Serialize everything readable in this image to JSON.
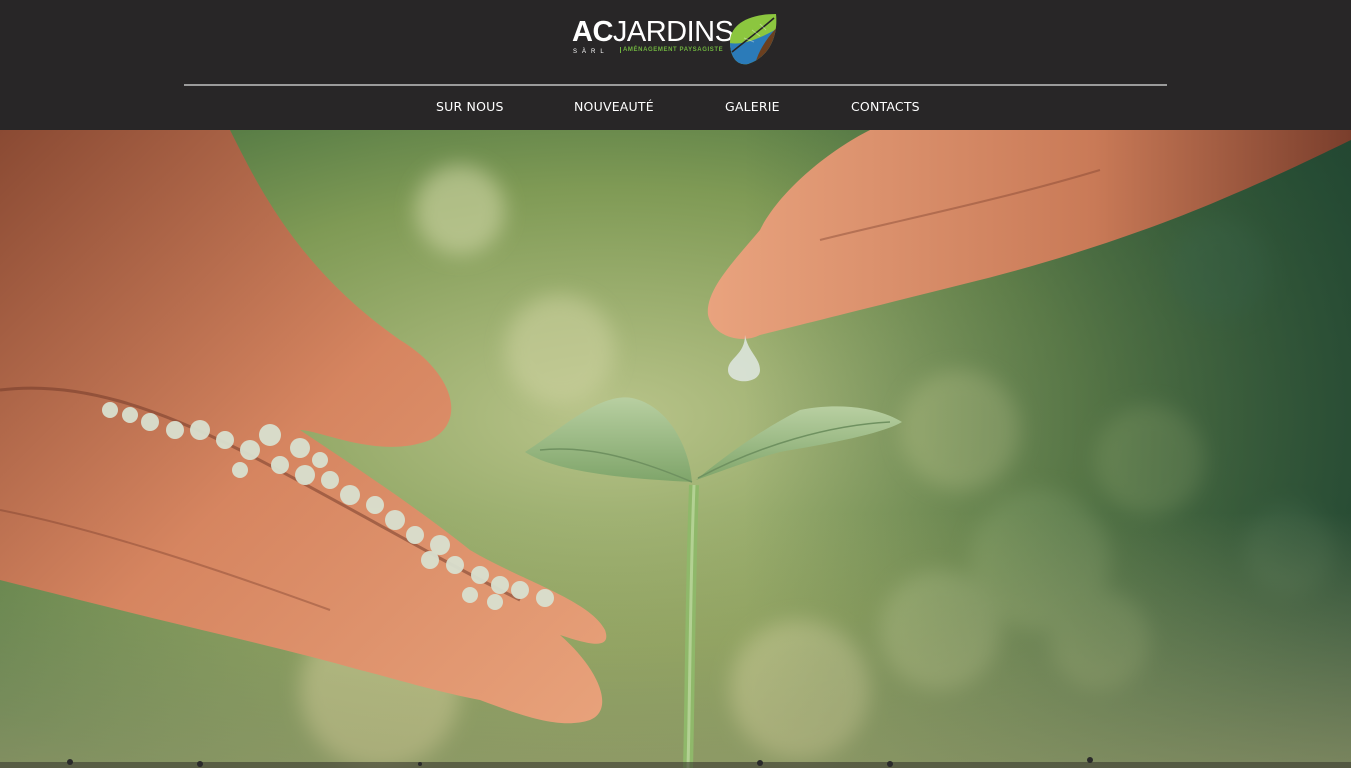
{
  "brand": {
    "name_bold": "AC",
    "name_rest": "JARDINS",
    "legal_form": "SÀRL",
    "tagline": "AMÉNAGEMENT PAYSAGISTE",
    "colors": {
      "header_bg": "#282627",
      "tagline_green": "#6fb33f",
      "leaf_green": "#8cc63f",
      "leaf_blue": "#2b7bb9",
      "leaf_brown": "#6b3f1f"
    }
  },
  "nav": {
    "items": [
      {
        "label": "SUR NOUS"
      },
      {
        "label": "NOUVEAUTÉ"
      },
      {
        "label": "GALERIE"
      },
      {
        "label": "CONTACTS"
      }
    ]
  },
  "hero": {
    "image_subject": "hands-seedling-water-drop"
  }
}
